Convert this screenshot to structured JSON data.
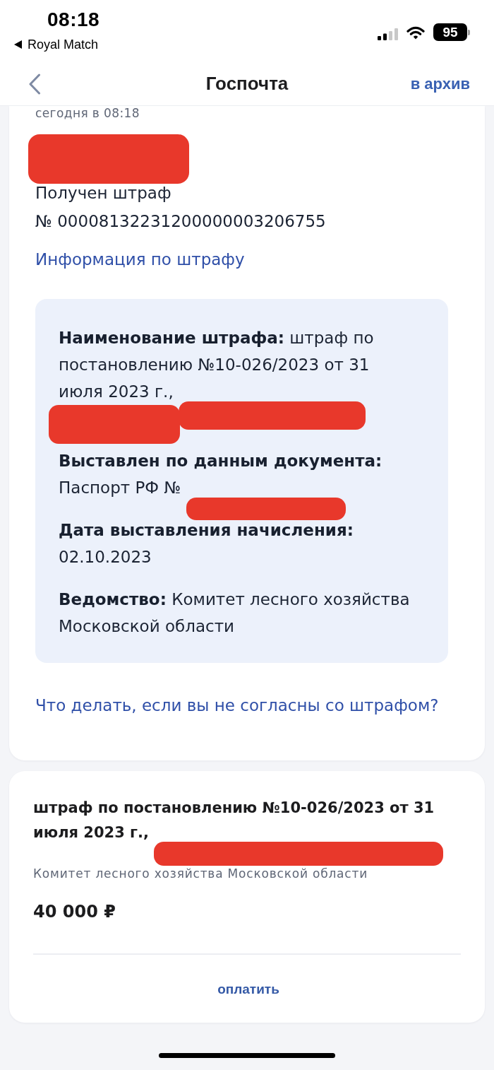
{
  "status_bar": {
    "time": "08:18",
    "back_app": "Royal Match",
    "battery": "95"
  },
  "nav_bar": {
    "title": "Госпочта",
    "action": "в архив"
  },
  "message": {
    "time": "сегодня в 08:18",
    "sender_redacted": true,
    "lines": [
      "Получен штраф",
      "№ 00008132231200000003206755"
    ],
    "info_link": "Информация по штрафу",
    "details": [
      {
        "label": "Наименование штрафа:",
        "segments": [
          {
            "kind": "text",
            "text": "штраф по постановлению №10-026/2023 от 31 июля 2023 г.,"
          },
          {
            "kind": "redaction"
          },
          {
            "kind": "redaction"
          }
        ]
      },
      {
        "label": "Выставлен по данным документа:",
        "segments": [
          {
            "kind": "text",
            "text": "Паспорт РФ №"
          },
          {
            "kind": "redaction"
          }
        ]
      },
      {
        "label": "Дата выставления начисления:",
        "segments": [
          {
            "kind": "text",
            "text": "02.10.2023"
          }
        ]
      },
      {
        "label": "Ведомство:",
        "segments": [
          {
            "kind": "text",
            "text": "Комитет лесного хозяйства Московской области"
          }
        ]
      }
    ],
    "dispute_link": "Что делать, если вы не согласны со штрафом?"
  },
  "payment_card": {
    "title_segments": [
      {
        "kind": "text",
        "text": "штраф по постановлению №10-026/2023 от 31 июля 2023 г.,"
      },
      {
        "kind": "redaction"
      }
    ],
    "agency": "Комитет лесного хозяйства Московской области",
    "amount": "40 000 ₽",
    "pay_button": "оплатить"
  }
}
